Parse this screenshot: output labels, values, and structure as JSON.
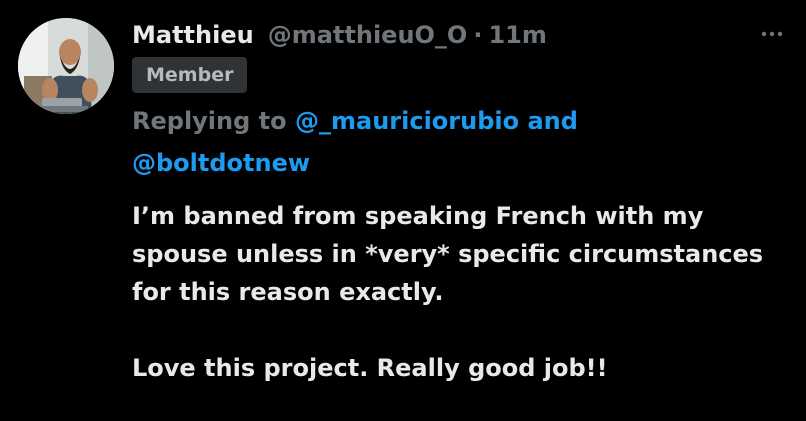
{
  "author": {
    "name": "Matthieu",
    "handle": "@matthieuO_O",
    "separator": "·",
    "time": "11m",
    "badge": "Member"
  },
  "reply": {
    "prefix": "Replying to",
    "mention1": "@_mauriciorubio",
    "joiner": "and",
    "mention2": "@boltdotnew"
  },
  "tweet": {
    "paragraph1": "I’m banned from speaking French with my spouse unless in *very* specific circumstances for this reason exactly.",
    "paragraph2": "Love this project. Really good job!!"
  },
  "icons": {
    "more": "more-horizontal-icon"
  },
  "colors": {
    "background": "#000000",
    "text": "#e7e9ea",
    "secondary": "#71767b",
    "link": "#1d9bf0",
    "badge_bg": "#2f3336"
  }
}
